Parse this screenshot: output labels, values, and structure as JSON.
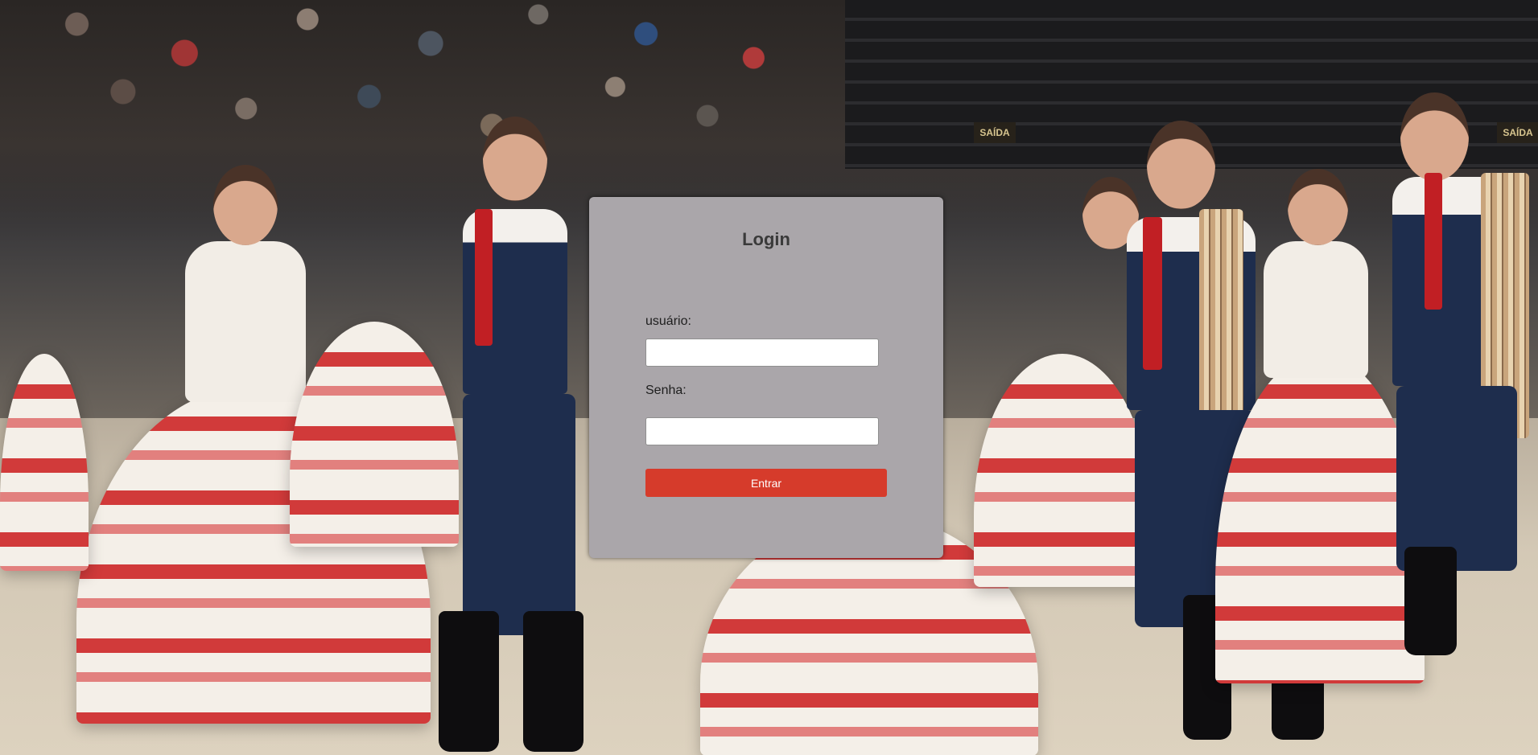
{
  "login": {
    "title": "Login",
    "username_label": "usuário:",
    "username_value": "",
    "password_label": "Senha:",
    "password_value": "",
    "submit_label": "Entrar"
  },
  "background": {
    "sign_text": "SAÍDA"
  },
  "colors": {
    "panel": "#aaa6aa",
    "button": "#d63b2b",
    "button_text": "#ffffff"
  }
}
